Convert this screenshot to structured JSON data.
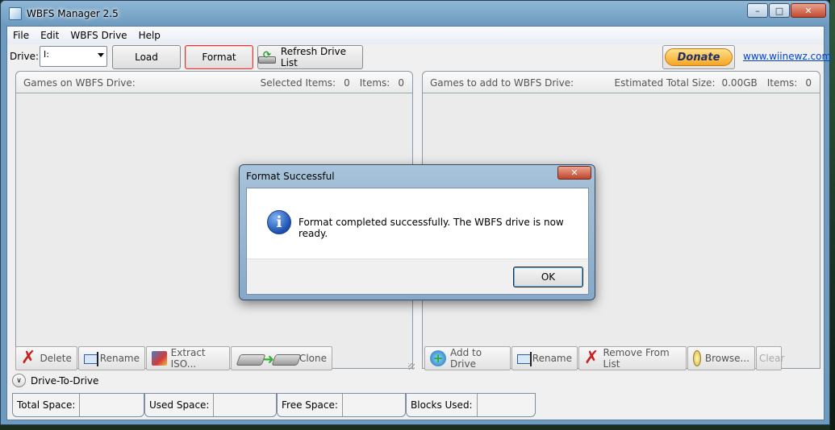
{
  "window": {
    "title": "WBFS Manager 2.5"
  },
  "menu": [
    "File",
    "Edit",
    "WBFS Drive",
    "Help"
  ],
  "toolbar": {
    "drive_label": "Drive:",
    "drive_value": "I:",
    "load_label": "Load",
    "format_label": "Format",
    "refresh_label": "Refresh Drive List",
    "donate_label": "Donate",
    "site_link": "www.wiinewz.com"
  },
  "left_panel": {
    "title": "Games on WBFS Drive:",
    "selected_label": "Selected Items:",
    "selected_value": "0",
    "items_label": "Items:",
    "items_value": "0",
    "buttons": {
      "delete": "Delete",
      "rename": "Rename",
      "extract": "Extract ISO...",
      "clone": "Clone"
    }
  },
  "right_panel": {
    "title": "Games to add to WBFS Drive:",
    "size_label": "Estimated Total Size:",
    "size_value": "0.00GB",
    "items_label": "Items:",
    "items_value": "0",
    "buttons": {
      "add": "Add to Drive",
      "rename": "Rename",
      "remove": "Remove From List",
      "browse": "Browse...",
      "clear": "Clear"
    }
  },
  "drive_to_drive": {
    "label": "Drive-To-Drive"
  },
  "status": {
    "total_label": "Total Space:",
    "used_label": "Used Space:",
    "free_label": "Free Space:",
    "blocks_label": "Blocks Used:"
  },
  "dialog": {
    "title": "Format Successful",
    "message": "Format completed successfully. The WBFS drive is now ready.",
    "ok_label": "OK"
  },
  "icons": {
    "app": "app-icon",
    "minimize": "minimize-icon",
    "maximize": "maximize-icon",
    "close": "close-icon",
    "info": "info-icon",
    "delete": "red-x-icon",
    "rename": "rename-icon",
    "extract": "extract-icon",
    "clone": "clone-drives-icon",
    "add": "add-disc-icon",
    "browse": "browse-icon",
    "refresh": "refresh-drive-icon"
  },
  "colors": {
    "link": "#0044cc",
    "focus_border": "#d83b3b",
    "donate": "#f5a623"
  }
}
